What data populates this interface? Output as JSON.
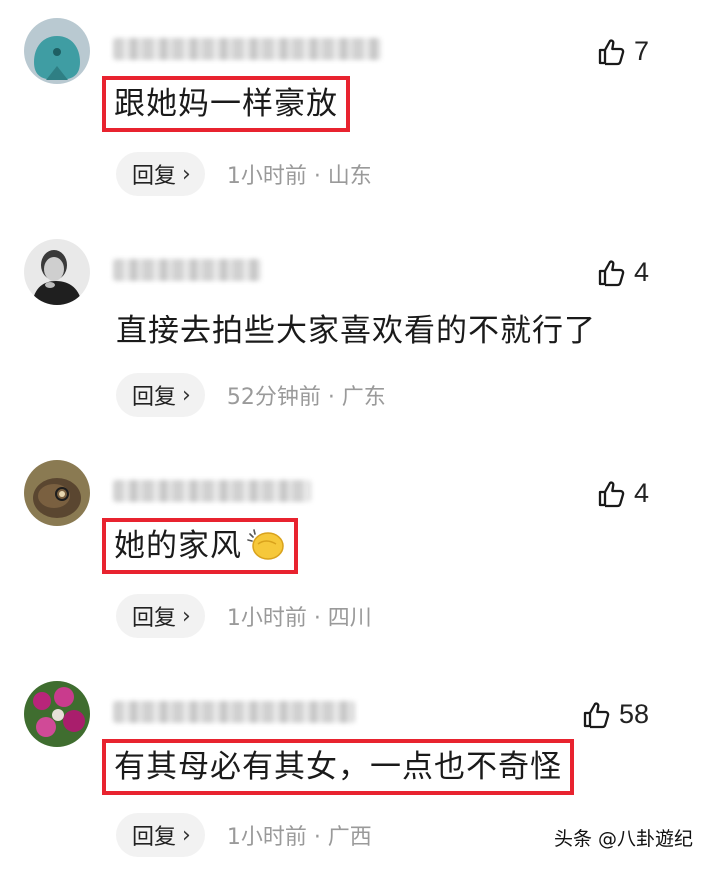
{
  "comments": [
    {
      "text": "跟她妈一样豪放",
      "likes": "7",
      "reply_label": "回复",
      "meta": "1小时前 · 山东",
      "highlighted": true,
      "emoji": ""
    },
    {
      "text": "直接去拍些大家喜欢看的不就行了",
      "likes": "4",
      "reply_label": "回复",
      "meta": "52分钟前 · 广东",
      "highlighted": false,
      "emoji": ""
    },
    {
      "text": "她的家风",
      "likes": "4",
      "reply_label": "回复",
      "meta": "1小时前 · 四川",
      "highlighted": true,
      "emoji": "clapping-hands-icon"
    },
    {
      "text": "有其母必有其女，一点也不奇怪",
      "likes": "58",
      "reply_label": "回复",
      "meta": "1小时前 · 广西",
      "highlighted": true,
      "emoji": ""
    }
  ],
  "watermark": "头条 @八卦遊纪",
  "colors": {
    "highlight_box": "#e8232f",
    "meta_text": "#9a9a9a",
    "reply_bg": "#f2f2f2"
  }
}
